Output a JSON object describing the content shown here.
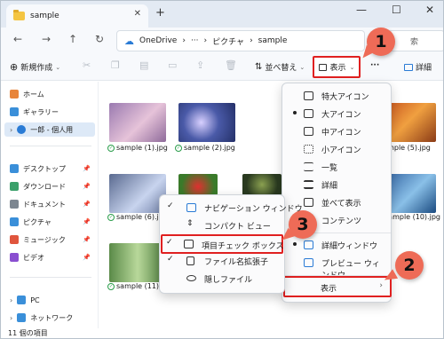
{
  "window": {
    "tab_title": "sample",
    "tab_close": "✕",
    "tab_add": "+",
    "minimize": "—",
    "maximize": "☐",
    "close": "✕"
  },
  "nav": {
    "back": "←",
    "forward": "→",
    "up": "↑",
    "refresh": "↻",
    "breadcrumb": [
      "OneDrive",
      "›",
      "···",
      "›",
      "ピクチャ",
      "›",
      "sample"
    ],
    "search_placeholder": "索"
  },
  "command_bar": {
    "new_label": "新規作成",
    "sort_label": "並べ替え",
    "view_label": "表示",
    "more": "···",
    "details_label": "詳細"
  },
  "sidebar": {
    "items": [
      {
        "label": "ホーム",
        "icon": "home-icon",
        "color": "#e8853b"
      },
      {
        "label": "ギャラリー",
        "icon": "gallery-icon",
        "color": "#3a8fd9"
      },
      {
        "label": "一郎 - 個人用",
        "icon": "cloud-icon",
        "color": "#2a7bd5"
      },
      {
        "label": "デスクトップ",
        "icon": "desktop-icon",
        "color": "#3a8fd9"
      },
      {
        "label": "ダウンロード",
        "icon": "download-icon",
        "color": "#3aa06a"
      },
      {
        "label": "ドキュメント",
        "icon": "document-icon",
        "color": "#7c8690"
      },
      {
        "label": "ピクチャ",
        "icon": "pictures-icon",
        "color": "#3a8fd9"
      },
      {
        "label": "ミュージック",
        "icon": "music-icon",
        "color": "#e0553d"
      },
      {
        "label": "ビデオ",
        "icon": "video-icon",
        "color": "#8a4fd0"
      },
      {
        "label": "PC",
        "icon": "pc-icon",
        "color": "#3a8fd9"
      },
      {
        "label": "ネットワーク",
        "icon": "network-icon",
        "color": "#3a8fd9"
      }
    ]
  },
  "files": [
    {
      "name": "sample (1).jpg",
      "color": "#b48ab8"
    },
    {
      "name": "sample (2).jpg",
      "color": "#5a6fb8"
    },
    {
      "name": "sample (5).jpg",
      "color": "#d06a3a"
    },
    {
      "name": "sample (6).jpg",
      "color": "#7a8ab0"
    },
    {
      "name": "sample (10).jpg",
      "color": "#4a8ac0"
    },
    {
      "name": "sample (11).jpg",
      "color": "#7aa868"
    }
  ],
  "status": {
    "count": "11 個の項目"
  },
  "view_menu": {
    "items": [
      {
        "label": "特大アイコン"
      },
      {
        "label": "大アイコン",
        "selected": true
      },
      {
        "label": "中アイコン"
      },
      {
        "label": "小アイコン"
      },
      {
        "label": "一覧"
      },
      {
        "label": "詳細"
      },
      {
        "label": "並べて表示"
      },
      {
        "label": "コンテンツ"
      },
      {
        "label": "詳細ウィンドウ",
        "selected": true
      },
      {
        "label": "プレビュー ウィンドウ"
      },
      {
        "label": "表示",
        "submenu": true
      }
    ]
  },
  "show_submenu": {
    "items": [
      {
        "label": "ナビゲーション ウィンドウ",
        "checked": true
      },
      {
        "label": "コンパクト ビュー",
        "checked": false
      },
      {
        "label": "項目チェック ボックス",
        "checked": true
      },
      {
        "label": "ファイル名拡張子",
        "checked": true
      },
      {
        "label": "隠しファイル",
        "checked": false
      }
    ]
  },
  "annotations": {
    "step1": "1",
    "step2": "2",
    "step3": "3",
    "accent": "#e02020",
    "badge_color": "#ee6b57"
  }
}
